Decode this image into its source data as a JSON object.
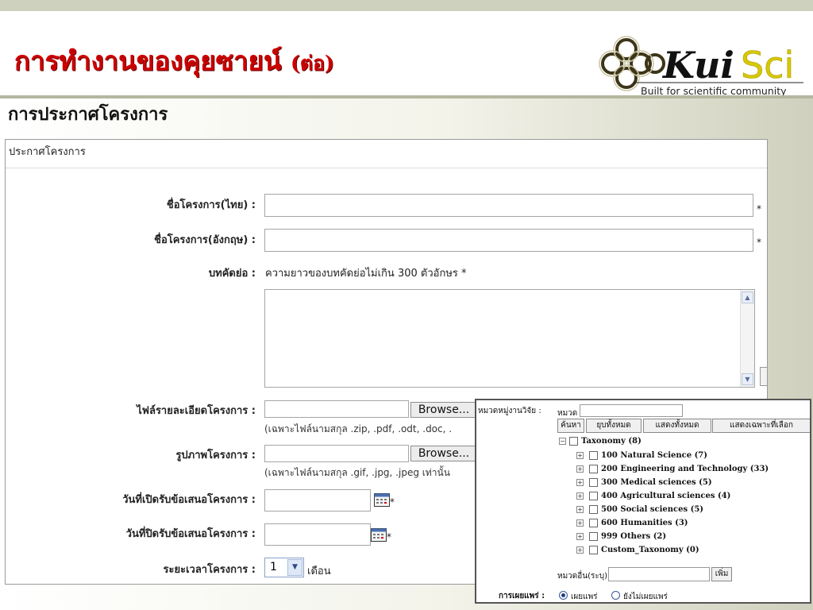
{
  "slide": {
    "title_main": "การทำงานของคุยซายน์",
    "title_sub": "(ต่อ)",
    "section_title": "การประกาศโครงการ",
    "logo": {
      "brand_kui": "Kui",
      "brand_sci": "Sci",
      "tagline": "Built for scientific community",
      "icon": "molecule-rings-icon"
    }
  },
  "form": {
    "header": "ประกาศโครงการ",
    "required_mark": "*",
    "fields": {
      "name_th": {
        "label": "ชื่อโครงการ(ไทย) :",
        "value": ""
      },
      "name_en": {
        "label": "ชื่อโครงการ(อังกฤษ) :",
        "value": ""
      },
      "abstract": {
        "label": "บทคัดย่อ :",
        "note": "ความยาวของบทคัดย่อไม่เกิน 300 ตัวอักษร *",
        "value": ""
      },
      "detail_file": {
        "label": "ไฟล์รายละเอียดโครงการ :",
        "button": "Browse...",
        "hint": "(เฉพาะไฟล์นามสกุล .zip, .pdf, .odt, .doc, ."
      },
      "image": {
        "label": "รูปภาพโครงการ :",
        "button": "Browse...",
        "hint": "(เฉพาะไฟล์นามสกุล .gif, .jpg, .jpeg เท่านั้น"
      },
      "open_date": {
        "label": "วันที่เปิดรับข้อเสนอโครงการ :",
        "value": ""
      },
      "close_date": {
        "label": "วันที่ปิดรับข้อเสนอโครงการ :",
        "value": ""
      },
      "duration": {
        "label": "ระยะเวลาโครงการ :",
        "selected": "1",
        "unit": "เดือน"
      }
    }
  },
  "category_popup": {
    "label": "หมวดหมู่งานวิจัย :",
    "search_label": "หมวด",
    "search_value": "",
    "buttons": {
      "search": "ค้นหา",
      "collapse_all": "ยุบทั้งหมด",
      "show_all": "แสดงทั้งหมด",
      "show_selected": "แสดงเฉพาะที่เลือก"
    },
    "tree_root": "Taxonomy (8)",
    "tree_items": [
      "100 Natural Science (7)",
      "200 Engineering and Technology (33)",
      "300 Medical sciences (5)",
      "400 Agricultural sciences (4)",
      "500 Social sciences (5)",
      "600 Humanities (3)",
      "999 Others (2)",
      "Custom_Taxonomy (0)"
    ],
    "other_label": "หมวดอื่น(ระบุ)",
    "other_value": "",
    "add_button": "เพิ่ม",
    "publish_label": "การเผยแพร่ :",
    "publish_options": [
      "เผยแพร่",
      "ยังไม่เผยแพร่"
    ],
    "publish_selected": "เผยแพร่"
  }
}
